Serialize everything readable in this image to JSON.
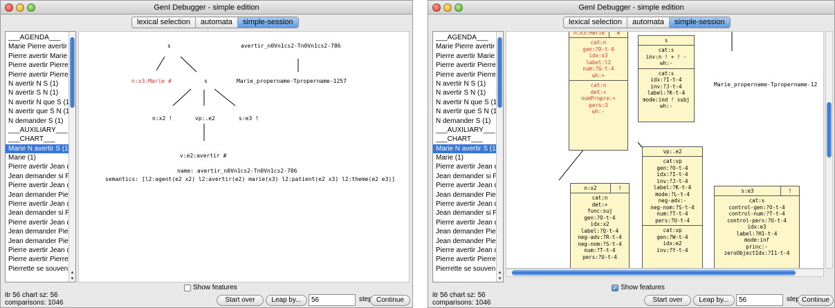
{
  "window_title": "GenI Debugger - simple edition",
  "tabs": [
    "lexical selection",
    "automata",
    "simple-session"
  ],
  "active_tab": "simple-session",
  "sidebar_items": [
    "___AGENDA___",
    "Marie Pierre avertir",
    "Pierre avertir Marie",
    "Pierre avertir Pierre",
    "Pierre avertir Pierre",
    "N avertir N S (1)",
    "N avertir S N (1)",
    "N avertir N que S (1)",
    "N avertir que S N (1)",
    "N demander S (1)",
    "___AUXILIARY___",
    "___CHART___",
    "Marie N avertir S (1)",
    "Marie (1)",
    "Pierre avertir Jean d",
    "Jean demander si Pi",
    "Pierre avertir Jean d",
    "Jean demander Pier",
    "Pierre avertir Jean d",
    "Jean demander si Pi",
    "Pierre avertir Jean d",
    "Jean demander Pier",
    "Jean demander Pier",
    "Pierre avertir Jean d",
    "Pierre avertir Pierre",
    "Pierrette se souven"
  ],
  "selected_item": "Marie N avertir S (1)",
  "left": {
    "tree": {
      "s_top": "s",
      "anchor": "avertir_n0Vn1cs2-Tn0Vn1cs2-786",
      "marie_red": "n:x3:Marie #",
      "s_mid": "s",
      "propername": "Marie_propername-Tpropername-1257",
      "n_x2": "n:x2 !",
      "vp_e2": "vp:.e2",
      "s_e3": "s:e3 !",
      "v_e2": "v:e2:avertir #"
    },
    "name_line": "name: avertir_n0Vn1cs2-Tn0Vn1cs2-786",
    "semantics_line": "semantics: [l2:agent(e2 x2) l2:avertir(e2) marie(x3) l2:patient(e2 x3) l2:theme(e2 e3)]",
    "show_features_label": "Show features",
    "show_features_checked": false
  },
  "right": {
    "nodes": {
      "marie": {
        "head": "n:x3:Marie",
        "mark": "#",
        "sec1": [
          "cat:n",
          "gen:?D-t-4",
          "idx:x3",
          "label:l2",
          "num:?G-t-4",
          "wh:+"
        ],
        "sec2": [
          "cat:n",
          "det:+",
          "nomPropre:+",
          "pers:3",
          "wh:-"
        ]
      },
      "s": {
        "head": "s",
        "sec1": [
          "cat:s",
          "inv:n ! + ! -",
          "wh:-"
        ],
        "sec2": [
          "cat:s",
          "idx:?I-t-4",
          "inv:?J-t-4",
          "label:?K-t-4",
          "mode:ind ! subj",
          "wh:-"
        ]
      },
      "vp": {
        "head": "vp:.e2",
        "sec1": [
          "cat:vp",
          "gen:?O-t-4",
          "idx:?I-t-4",
          "inv:?J-t-4",
          "label:?K-t-4",
          "mode:?L-t-4",
          "neg-adv:-",
          "neg-nom:?S-t-4",
          "num:?T-t-4",
          "pers:?U-t-4"
        ],
        "sec2": [
          "cat:vp",
          "gen:?W-t-4",
          "idx:e2",
          "inv:?Y-t-4"
        ]
      },
      "nx2": {
        "head": "n:x2",
        "mark": "!",
        "sec1": [
          "cat:n",
          "det:+",
          "func:suj",
          "gen:?O-t-4",
          "idx:x2",
          "label:?Q-t-4",
          "neg-adv:?R-t-4",
          "neg-nom:?S-t-4",
          "num:?T-t-4",
          "pers:?U-t-4"
        ]
      },
      "se3": {
        "head": "s:e3",
        "mark": "!",
        "sec1": [
          "cat:s",
          "control-gen:?O-t-4",
          "control-num:?T-t-4",
          "control-pers:?U-t-4",
          "idx:e3",
          "label:?H1-t-4",
          "mode:inf",
          "princ:-",
          "zeroObjectIdx:?I1-t-4"
        ]
      }
    },
    "propername": "Marie_propername-Tpropername-12",
    "show_features_label": "Show features",
    "show_features_checked": true
  },
  "status_line1": "itr 56 chart sz: 56",
  "status_line2": "comparisons: 1046",
  "buttons": {
    "start_over": "Start over",
    "leap_by": "Leap by...",
    "continue": "Continue"
  },
  "step_value": "56",
  "step_label": "step(s)"
}
